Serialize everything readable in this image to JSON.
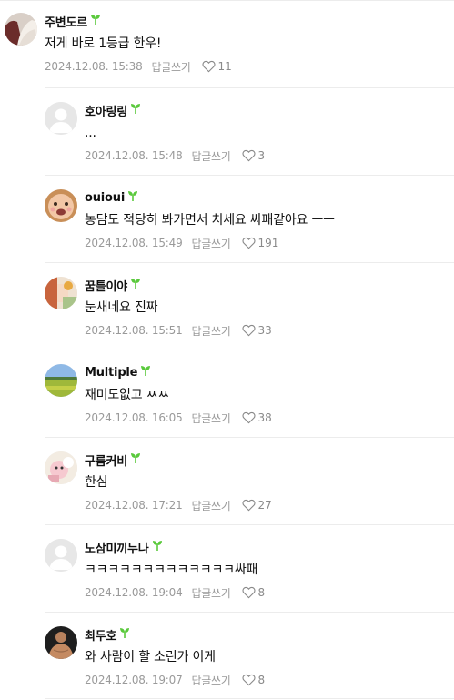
{
  "colors": {
    "sprout": "#5ac93c",
    "meta": "#9a9a9a",
    "divider": "#ececec"
  },
  "comment": {
    "nickname": "주변도르",
    "text": "저게 바로 1등급 한우!",
    "date": "2024.12.08. 15:38",
    "reply_label": "답글쓰기",
    "likes": "11",
    "badge_icon": "sprout-icon",
    "like_icon": "heart-icon"
  },
  "replies": [
    {
      "nickname": "호아링링",
      "text": "...",
      "date": "2024.12.08. 15:48",
      "reply_label": "답글쓰기",
      "likes": "3",
      "avatar": "default-avatar"
    },
    {
      "nickname": "ouioui",
      "text": "농담도 적당히 봐가면서 치세요 싸패같아요 ㅡㅡ",
      "date": "2024.12.08. 15:49",
      "reply_label": "답글쓰기",
      "likes": "191",
      "avatar": "baby-avatar"
    },
    {
      "nickname": "꿈틀이야",
      "text": "눈새네요 진짜",
      "date": "2024.12.08. 15:51",
      "reply_label": "답글쓰기",
      "likes": "33",
      "avatar": "photo-avatar"
    },
    {
      "nickname": "Multiple",
      "text": "재미도없고 ㅉㅉ",
      "date": "2024.12.08. 16:05",
      "reply_label": "답글쓰기",
      "likes": "38",
      "avatar": "landscape-avatar"
    },
    {
      "nickname": "구름커비",
      "text": "한심",
      "date": "2024.12.08. 17:21",
      "reply_label": "답글쓰기",
      "likes": "27",
      "avatar": "character-avatar"
    },
    {
      "nickname": "노삼미끼누나",
      "text": "ㅋㅋㅋㅋㅋㅋㅋㅋㅋㅋㅋㅋㅋ싸패",
      "date": "2024.12.08. 19:04",
      "reply_label": "답글쓰기",
      "likes": "8",
      "avatar": "default-avatar"
    },
    {
      "nickname": "최두호",
      "text": "와 사람이 할 소린가 이게",
      "date": "2024.12.08. 19:07",
      "reply_label": "답글쓰기",
      "likes": "8",
      "avatar": "fighter-avatar"
    }
  ]
}
